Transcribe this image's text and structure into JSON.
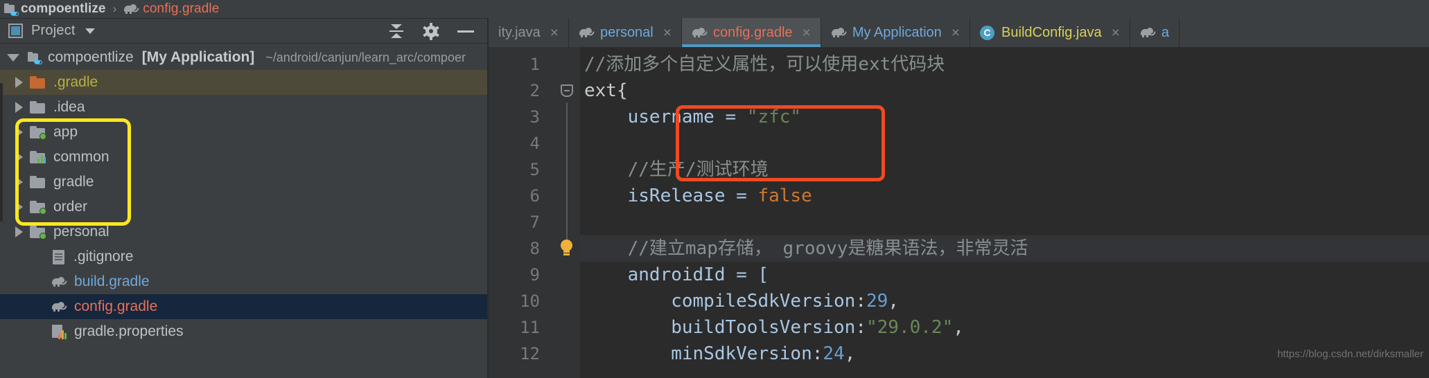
{
  "breadcrumb": {
    "project": "compoentlize",
    "separator": "›",
    "file": "config.gradle",
    "project_icon": "module-icon",
    "file_icon": "gradle-elephant-icon"
  },
  "project_panel": {
    "title": "Project",
    "title_icon": "project-window-icon",
    "dropdown_icon": "chevron-down-icon",
    "actions": [
      {
        "name": "collapse-all-button",
        "icon": "collapse-all-icon"
      },
      {
        "name": "settings-button",
        "icon": "gear-icon"
      },
      {
        "name": "hide-panel-button",
        "icon": "minus-icon"
      }
    ],
    "tree": [
      {
        "label": "compoentlize",
        "badge": "[My Application]",
        "path": "~/android/canjun/learn_arc/compoer",
        "icon": "module-icon",
        "arrow": "open",
        "depth": 0,
        "state": "root"
      },
      {
        "label": ".gradle",
        "icon": "folder-orange-icon",
        "arrow": "closed",
        "depth": 1,
        "state": "highlighted",
        "color": "olive"
      },
      {
        "label": ".idea",
        "icon": "folder-icon",
        "arrow": "closed",
        "depth": 1,
        "state": "normal"
      },
      {
        "label": "app",
        "icon": "folder-module-icon",
        "arrow": "closed",
        "depth": 1,
        "state": "normal"
      },
      {
        "label": "common",
        "icon": "folder-library-icon",
        "arrow": "closed",
        "depth": 1,
        "state": "normal"
      },
      {
        "label": "gradle",
        "icon": "folder-icon",
        "arrow": "closed",
        "depth": 1,
        "state": "normal"
      },
      {
        "label": "order",
        "icon": "folder-module-icon",
        "arrow": "closed",
        "depth": 1,
        "state": "normal"
      },
      {
        "label": "personal",
        "icon": "folder-module-icon",
        "arrow": "closed",
        "depth": 1,
        "state": "normal"
      },
      {
        "label": ".gitignore",
        "icon": "text-file-icon",
        "arrow": "none",
        "depth": 1,
        "state": "normal"
      },
      {
        "label": "build.gradle",
        "icon": "gradle-elephant-icon",
        "arrow": "none",
        "depth": 1,
        "state": "normal",
        "color": "blue"
      },
      {
        "label": "config.gradle",
        "icon": "gradle-elephant-icon",
        "arrow": "none",
        "depth": 1,
        "state": "selected",
        "color": "red"
      },
      {
        "label": "gradle.properties",
        "icon": "properties-file-icon",
        "arrow": "none",
        "depth": 1,
        "state": "normal"
      }
    ]
  },
  "annotations": {
    "yellow_box": {
      "color": "#ffe81f",
      "covers": "app, common, gradle, order, personal modules"
    },
    "red_box": {
      "color": "#f04a22",
      "covers": "isRelease comment and assignment lines"
    }
  },
  "editor": {
    "tabs": [
      {
        "label": "ity.java",
        "icon": "none",
        "close": "×",
        "active": false,
        "color": "dim"
      },
      {
        "label": "personal",
        "icon": "gradle-elephant-icon",
        "close": "×",
        "active": false,
        "color": "blue"
      },
      {
        "label": "config.gradle",
        "icon": "gradle-elephant-icon",
        "close": "×",
        "active": true,
        "color": "red"
      },
      {
        "label": "My Application",
        "icon": "gradle-elephant-icon",
        "close": "×",
        "active": false,
        "color": "blue"
      },
      {
        "label": "BuildConfig.java",
        "icon": "java-class-icon",
        "close": "×",
        "active": false,
        "color": "yellow"
      },
      {
        "label": "a",
        "icon": "gradle-elephant-icon",
        "close": "",
        "active": false,
        "color": "blue"
      }
    ],
    "line_numbers": [
      "1",
      "2",
      "3",
      "4",
      "5",
      "6",
      "7",
      "8",
      "9",
      "10",
      "11",
      "12"
    ],
    "gutter_icons": {
      "fold_line_2": "fold-collapse-icon",
      "bulb_line_8": "intention-bulb-icon"
    },
    "lines": [
      {
        "n": 1,
        "tokens": [
          {
            "t": "//添加多个自定义属性，可以使用ext代码块",
            "c": "c-comment"
          }
        ]
      },
      {
        "n": 2,
        "tokens": [
          {
            "t": "ext{",
            "c": "c-plain"
          }
        ]
      },
      {
        "n": 3,
        "tokens": [
          {
            "t": "    username = ",
            "c": "c-ident"
          },
          {
            "t": "\"zfc\"",
            "c": "c-string"
          }
        ]
      },
      {
        "n": 4,
        "tokens": [
          {
            "t": "",
            "c": "c-plain"
          }
        ]
      },
      {
        "n": 5,
        "tokens": [
          {
            "t": "    //生产/测试环境",
            "c": "c-comment"
          }
        ]
      },
      {
        "n": 6,
        "tokens": [
          {
            "t": "    isRelease = ",
            "c": "c-ident"
          },
          {
            "t": "false",
            "c": "c-kw"
          }
        ]
      },
      {
        "n": 7,
        "tokens": [
          {
            "t": "",
            "c": "c-plain"
          }
        ]
      },
      {
        "n": 8,
        "tokens": [
          {
            "t": "    //建立map存储， groovy是糖果语法，非常灵活",
            "c": "c-comment"
          }
        ]
      },
      {
        "n": 9,
        "tokens": [
          {
            "t": "    androidId = [",
            "c": "c-ident"
          }
        ]
      },
      {
        "n": 10,
        "tokens": [
          {
            "t": "        compileSdkVersion",
            "c": "c-ident"
          },
          {
            "t": ":",
            "c": "c-plain"
          },
          {
            "t": "29",
            "c": "c-num"
          },
          {
            "t": ",",
            "c": "c-plain"
          }
        ]
      },
      {
        "n": 11,
        "tokens": [
          {
            "t": "        buildToolsVersion",
            "c": "c-ident"
          },
          {
            "t": ":",
            "c": "c-plain"
          },
          {
            "t": "\"29.0.2\"",
            "c": "c-string"
          },
          {
            "t": ",",
            "c": "c-plain"
          }
        ]
      },
      {
        "n": 12,
        "tokens": [
          {
            "t": "        minSdkVersion",
            "c": "c-ident"
          },
          {
            "t": ":",
            "c": "c-plain"
          },
          {
            "t": "24",
            "c": "c-num"
          },
          {
            "t": ",",
            "c": "c-plain"
          }
        ]
      }
    ],
    "highlighted_line": 8
  },
  "watermark": "https://blog.csdn.net/dirksmaller"
}
